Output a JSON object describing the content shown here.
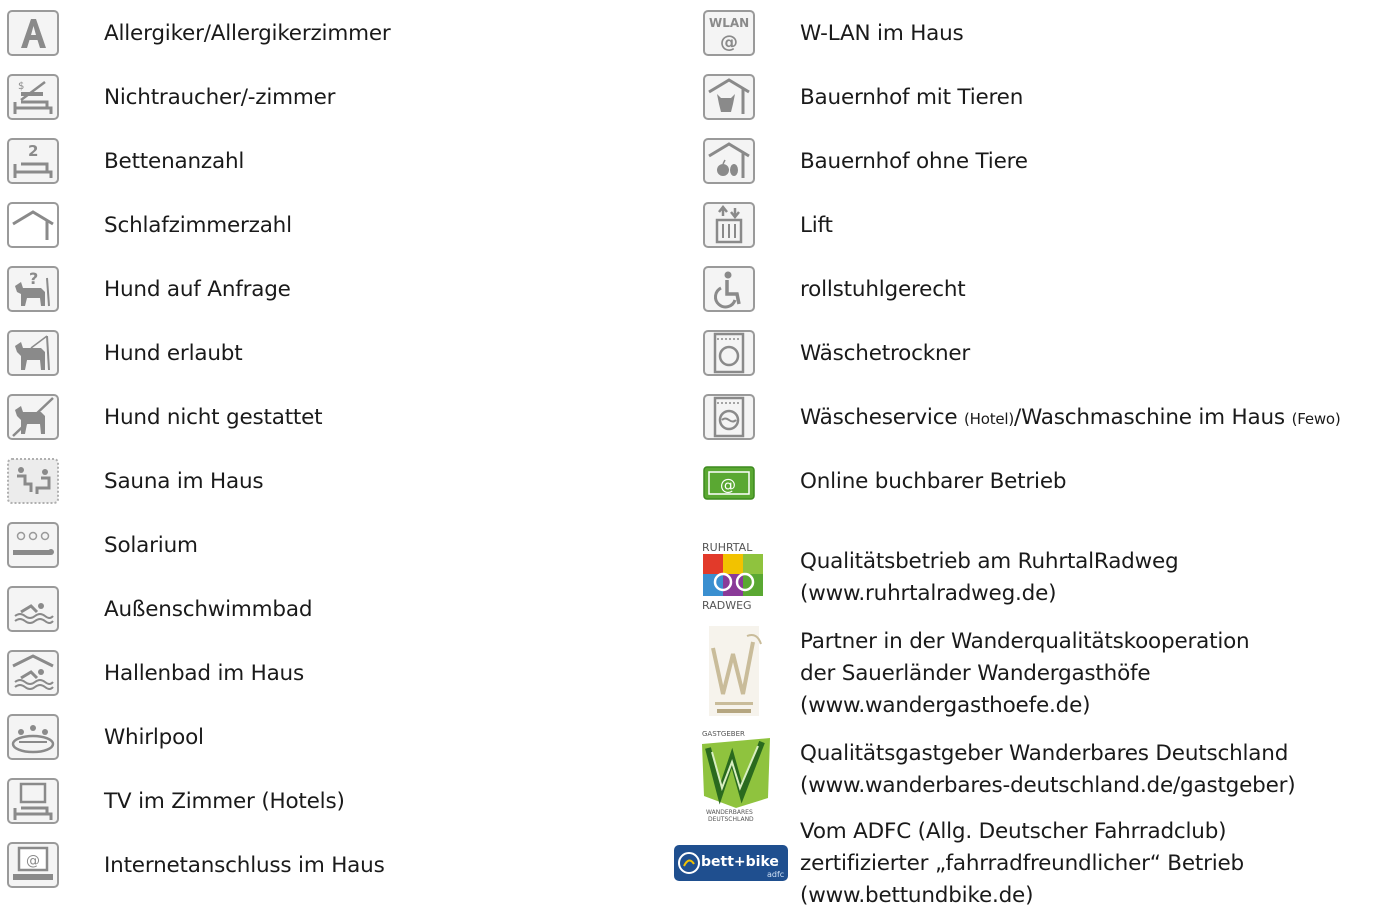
{
  "left": [
    {
      "label": "Allergiker/Allergikerzimmer",
      "icon": "allergy-icon"
    },
    {
      "label": "Nichtraucher/-zimmer",
      "icon": "non-smoking-icon"
    },
    {
      "label": "Bettenanzahl",
      "icon": "bed-count-icon"
    },
    {
      "label": "Schlafzimmerzahl",
      "icon": "bedroom-count-icon"
    },
    {
      "label": "Hund auf Anfrage",
      "icon": "dog-on-request-icon"
    },
    {
      "label": "Hund erlaubt",
      "icon": "dog-allowed-icon"
    },
    {
      "label": "Hund nicht gestattet",
      "icon": "dog-not-allowed-icon"
    },
    {
      "label": "Sauna im Haus",
      "icon": "sauna-icon"
    },
    {
      "label": "Solarium",
      "icon": "solarium-icon"
    },
    {
      "label": "Außenschwimmbad",
      "icon": "outdoor-pool-icon"
    },
    {
      "label": "Hallenbad im Haus",
      "icon": "indoor-pool-icon"
    },
    {
      "label": "Whirlpool",
      "icon": "whirlpool-icon"
    },
    {
      "label": "TV im Zimmer (Hotels)",
      "icon": "tv-icon"
    },
    {
      "label": "Internetanschluss im Haus",
      "icon": "internet-icon"
    }
  ],
  "right": [
    {
      "label": "W-LAN im Haus",
      "icon": "wlan-icon",
      "icon_text_1": "WLAN",
      "icon_text_2": "@"
    },
    {
      "label": "Bauernhof mit Tieren",
      "icon": "farm-with-animals-icon"
    },
    {
      "label": "Bauernhof ohne Tiere",
      "icon": "farm-without-animals-icon"
    },
    {
      "label": "Lift",
      "icon": "lift-icon"
    },
    {
      "label": "rollstuhlgerecht",
      "icon": "wheelchair-icon"
    },
    {
      "label": "Wäschetrockner",
      "icon": "dryer-icon"
    },
    {
      "label_a": "Wäscheservice ",
      "label_b": "(Hotel)",
      "label_c": "/Waschmaschine im Haus ",
      "label_d": "(Fewo)",
      "icon": "washing-machine-icon"
    },
    {
      "label": "Online buchbarer Betrieb",
      "icon": "online-booking-icon",
      "icon_text": "@"
    }
  ],
  "badges": [
    {
      "lines": [
        "Qualitätsbetrieb am RuhrtalRadweg",
        "(www.ruhrtalradweg.de)"
      ],
      "icon": "ruhrtal-radweg-logo",
      "logo_top": "RUHRTAL",
      "logo_bottom": "RADWEG"
    },
    {
      "lines": [
        "Partner in der Wanderqualitätskooperation",
        "der Sauerländer Wandergasthöfe",
        "(www.wandergasthoefe.de)"
      ],
      "icon": "wandergasthoefe-logo"
    },
    {
      "lines": [
        "Qualitätsgastgeber Wanderbares Deutschland",
        "(www.wanderbares-deutschland.de/gastgeber)"
      ],
      "icon": "wanderbares-deutschland-logo"
    },
    {
      "lines": [
        "Vom ADFC (Allg. Deutscher Fahrradclub)",
        "zertifizierter „fahrradfreundlicher“ Betrieb",
        "(www.bettundbike.de)"
      ],
      "icon": "bett-und-bike-logo",
      "logo_text": "bett+bike",
      "logo_sub": "adfc"
    }
  ],
  "colors": {
    "icon_stroke": "#9a9a9a",
    "icon_bg": "#f4f4f4",
    "online_green": "#5aa832",
    "text": "#1a1a1a"
  }
}
